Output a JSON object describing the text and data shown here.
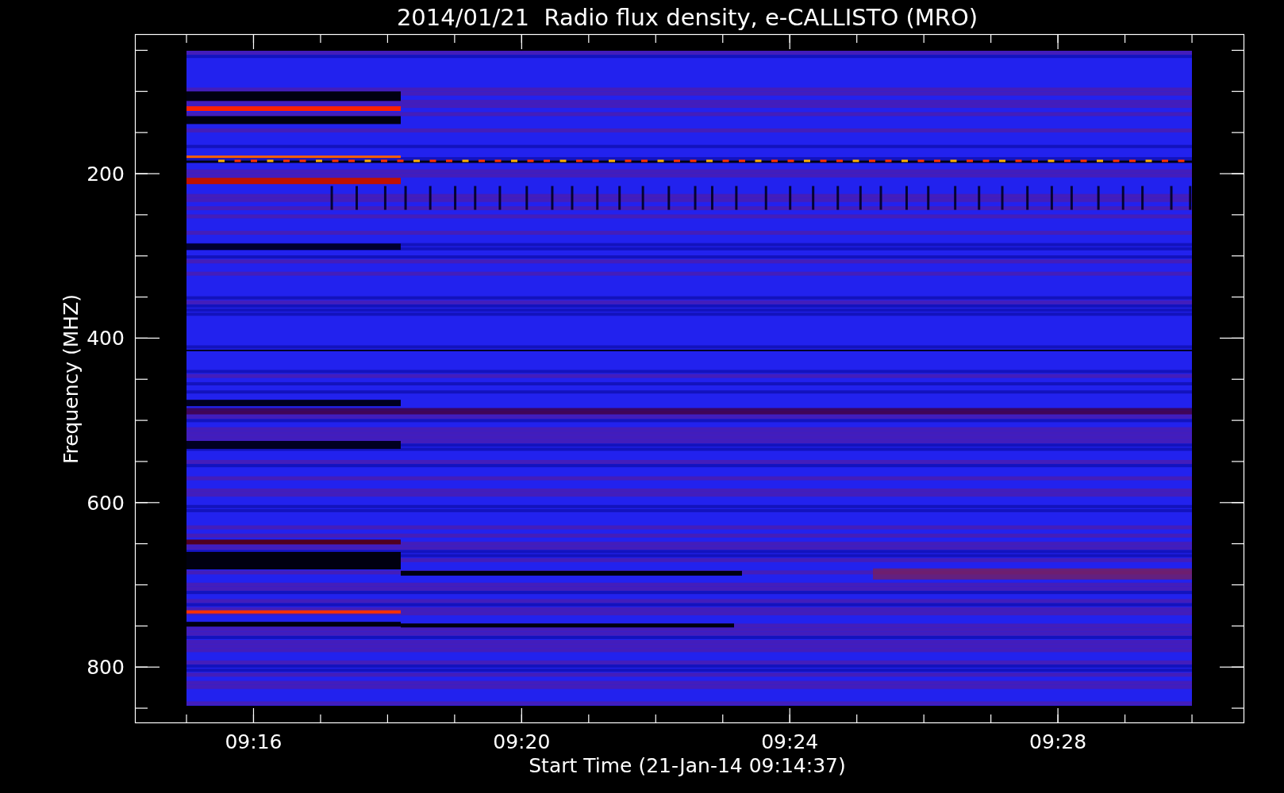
{
  "plot": {
    "title": "2014/01/21  Radio flux density, e-CALLISTO (MRO)",
    "xlabel": "Start Time (21-Jan-14 09:14:37)",
    "ylabel": "Frequency (MHZ)",
    "xtick_labels": [
      "09:16",
      "09:20",
      "09:24",
      "09:28"
    ],
    "ytick_labels": [
      "200",
      "400",
      "600",
      "800"
    ]
  }
}
